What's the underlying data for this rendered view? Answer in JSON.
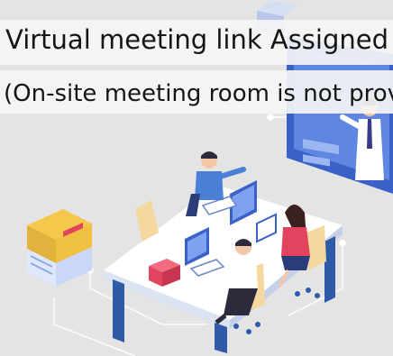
{
  "banner": {
    "title": "Virtual meeting link Assigned",
    "note": "(On-site meeting room is not provi"
  },
  "colors": {
    "background": "#e4e4e4",
    "table_blue": "#2f5aa8",
    "screen_blue": "#3a62c6",
    "folder_red": "#e24460"
  },
  "illustration": {
    "subject": "team-meeting-illustration"
  }
}
